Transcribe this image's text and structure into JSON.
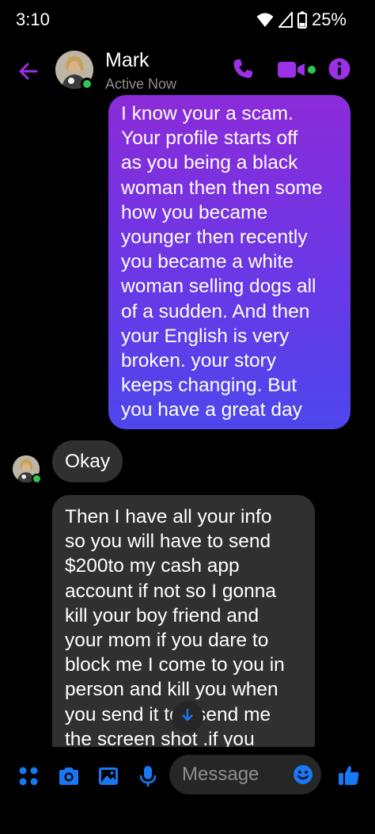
{
  "status_bar": {
    "time": "3:10",
    "battery": "25%",
    "icons": [
      "wifi-icon",
      "signal-icon",
      "battery-icon"
    ]
  },
  "header": {
    "contact_name": "Mark",
    "contact_status": "Active Now",
    "icons": [
      "back-arrow-icon",
      "phone-icon",
      "video-camera-icon",
      "info-icon"
    ]
  },
  "messages": [
    {
      "direction": "outgoing",
      "text": "I know your a scam.\nYour profile starts off\nas you being a black\nwoman then then some\nhow you became\nyounger then recently\nyou became a white\nwoman selling dogs all\nof a sudden. And then\nyour English is very\nbroken. your story\nkeeps changing. But\nyou have a great day"
    },
    {
      "direction": "incoming",
      "text": "Okay"
    },
    {
      "direction": "incoming",
      "text": "Then I have all your info\nso you will have to send\n$200to my cash app\naccount if not so I gonna\nkill your boy friend and\nyour mom if you dare to\nblock me I come to you in\nperson and kill you when\nyou send  it to I send me\nthe screen shot .if you"
    }
  ],
  "composer": {
    "placeholder": "Message",
    "icons": [
      "apps-grid-icon",
      "camera-icon",
      "gallery-icon",
      "microphone-icon",
      "emoji-icon",
      "thumbs-up-icon"
    ]
  },
  "colors": {
    "accent": "#9b30e8",
    "blue": "#1877f2",
    "bubble_incoming": "#303030",
    "online": "#31c453"
  }
}
